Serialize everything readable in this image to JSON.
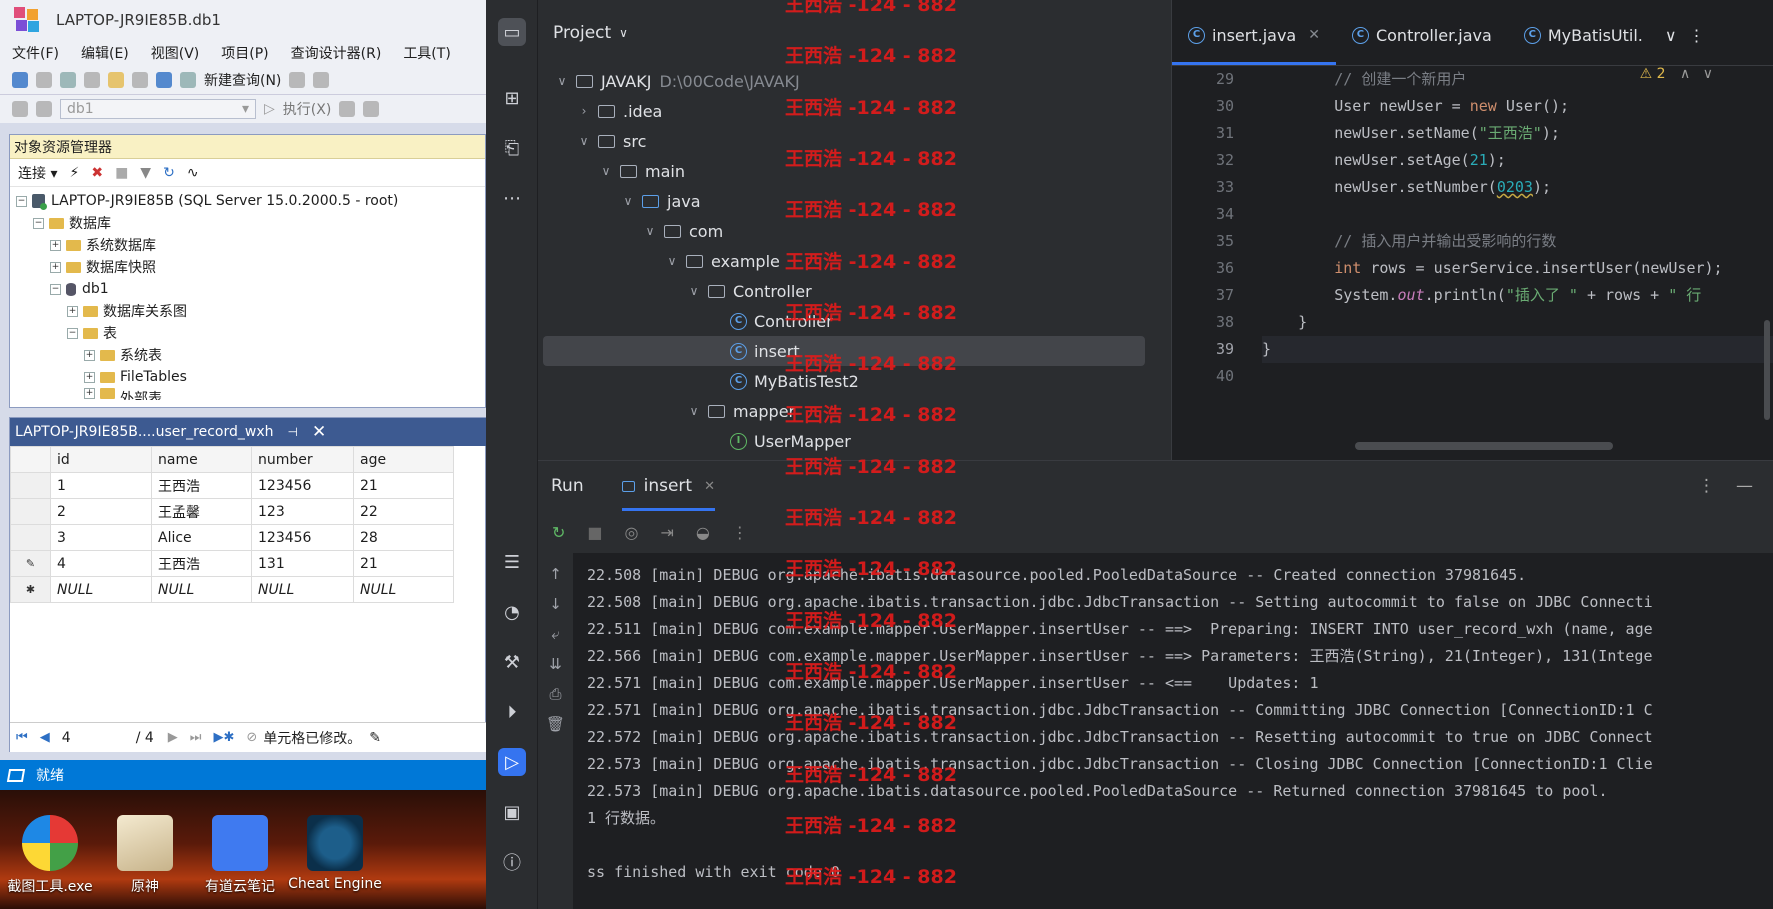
{
  "ssms": {
    "window_title": "LAPTOP-JR9IE85B.db1",
    "menu": [
      "文件(F)",
      "编辑(E)",
      "视图(V)",
      "项目(P)",
      "查询设计器(R)",
      "工具(T)"
    ],
    "toolbar": {
      "new_query": "新建查询(N)",
      "db_selected": "db1",
      "execute": "执行(X)"
    },
    "object_explorer": {
      "title": "对象资源管理器",
      "connect": "连接",
      "server": "LAPTOP-JR9IE85B (SQL Server 15.0.2000.5 - root)",
      "nodes": [
        "数据库",
        "系统数据库",
        "数据库快照",
        "db1",
        "数据库关系图",
        "表",
        "系统表",
        "FileTables",
        "外部表"
      ]
    },
    "grid": {
      "tab_title": "LAPTOP-JR9IE85B....user_record_wxh",
      "columns": [
        "id",
        "name",
        "number",
        "age"
      ],
      "rows": [
        [
          "1",
          "王西浩",
          "123456",
          "21"
        ],
        [
          "2",
          "王孟馨",
          "123",
          "22"
        ],
        [
          "3",
          "Alice",
          "123456",
          "28"
        ],
        [
          "4",
          "王西浩",
          "131",
          "21"
        ],
        [
          "NULL",
          "NULL",
          "NULL",
          "NULL"
        ]
      ],
      "nav": {
        "current": "4",
        "total": "/ 4",
        "status": "单元格已修改。"
      }
    },
    "status_text": "就绪"
  },
  "desktop": {
    "icons": [
      "截图工具.exe",
      "原神",
      "有道云笔记",
      "Cheat Engine"
    ]
  },
  "ide": {
    "project_title": "Project",
    "tree": [
      {
        "label": "JAVAKJ",
        "path": "D:\\00Code\\JAVAKJ"
      },
      {
        "label": ".idea"
      },
      {
        "label": "src"
      },
      {
        "label": "main"
      },
      {
        "label": "java"
      },
      {
        "label": "com"
      },
      {
        "label": "example"
      },
      {
        "label": "Controller"
      },
      {
        "label": "Controller"
      },
      {
        "label": "insert"
      },
      {
        "label": "MyBatisTest2"
      },
      {
        "label": "mapper"
      },
      {
        "label": "UserMapper"
      }
    ],
    "tabs": [
      "insert.java",
      "Controller.java",
      "MyBatisUtil."
    ],
    "warning_count": "2",
    "line_numbers": [
      "29",
      "30",
      "31",
      "32",
      "33",
      "34",
      "35",
      "36",
      "37",
      "38",
      "39",
      "40"
    ],
    "code": {
      "c1": "// 创建一个新用户",
      "c2": "// 插入用户并输出受影响的行数",
      "name_value": "\"王西浩\"",
      "age_value": "21",
      "number_value": "0203",
      "print_prefix": "\"插入了 \"",
      "print_suffix": "\" 行"
    },
    "run": {
      "title": "Run",
      "tab": "insert",
      "lines": [
        "22.508 [main] DEBUG org.apache.ibatis.datasource.pooled.PooledDataSource -- Created connection 37981645.",
        "22.508 [main] DEBUG org.apache.ibatis.transaction.jdbc.JdbcTransaction -- Setting autocommit to false on JDBC Connecti",
        "22.511 [main] DEBUG com.example.mapper.UserMapper.insertUser -- ==>  Preparing: INSERT INTO user_record_wxh (name, age",
        "22.566 [main] DEBUG com.example.mapper.UserMapper.insertUser -- ==> Parameters: 王西浩(String), 21(Integer), 131(Intege",
        "22.571 [main] DEBUG com.example.mapper.UserMapper.insertUser -- <==    Updates: 1",
        "22.571 [main] DEBUG org.apache.ibatis.transaction.jdbc.JdbcTransaction -- Committing JDBC Connection [ConnectionID:1 C",
        "22.572 [main] DEBUG org.apache.ibatis.transaction.jdbc.JdbcTransaction -- Resetting autocommit to true on JDBC Connect",
        "22.573 [main] DEBUG org.apache.ibatis.transaction.jdbc.JdbcTransaction -- Closing JDBC Connection [ConnectionID:1 Clie",
        "22.573 [main] DEBUG org.apache.ibatis.datasource.pooled.PooledDataSource -- Returned connection 37981645 to pool.",
        "1 行数据。",
        "",
        "ss finished with exit code 0"
      ]
    }
  },
  "watermark": "王西浩 -124 - 882"
}
